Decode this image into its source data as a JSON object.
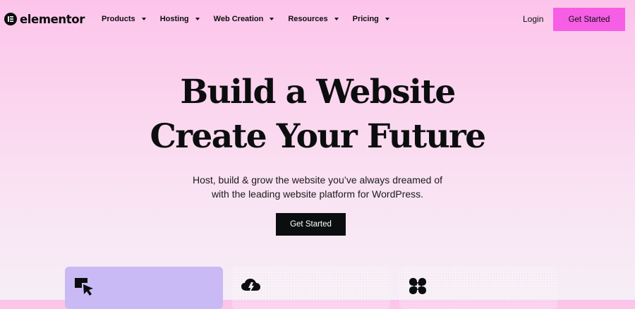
{
  "header": {
    "logo": {
      "icon": "elementor-logo-icon",
      "text": "elementor"
    },
    "nav": [
      {
        "label": "Products",
        "icon": "chevron-down-icon"
      },
      {
        "label": "Hosting",
        "icon": "chevron-down-icon"
      },
      {
        "label": "Web Creation",
        "icon": "chevron-down-icon"
      },
      {
        "label": "Resources",
        "icon": "chevron-down-icon"
      },
      {
        "label": "Pricing",
        "icon": "chevron-down-icon"
      }
    ],
    "login_label": "Login",
    "cta_label": "Get Started"
  },
  "hero": {
    "headline_line1": "Build a Website",
    "headline_line2": "Create Your Future",
    "subtitle_line1": "Host, build & grow the website you’ve always dreamed of",
    "subtitle_line2": "with the leading website platform for WordPress.",
    "cta_label": "Get Started"
  },
  "cards": [
    {
      "icon": "cursor-click-icon"
    },
    {
      "icon": "cloud-lightning-icon"
    },
    {
      "icon": "sparkle-grid-icon"
    }
  ],
  "colors": {
    "brand_pink": "#f65ee5",
    "text_dark": "#0c0d0e",
    "card_purple": "#c9b9f5",
    "background_pink": "#fcc4ea"
  }
}
